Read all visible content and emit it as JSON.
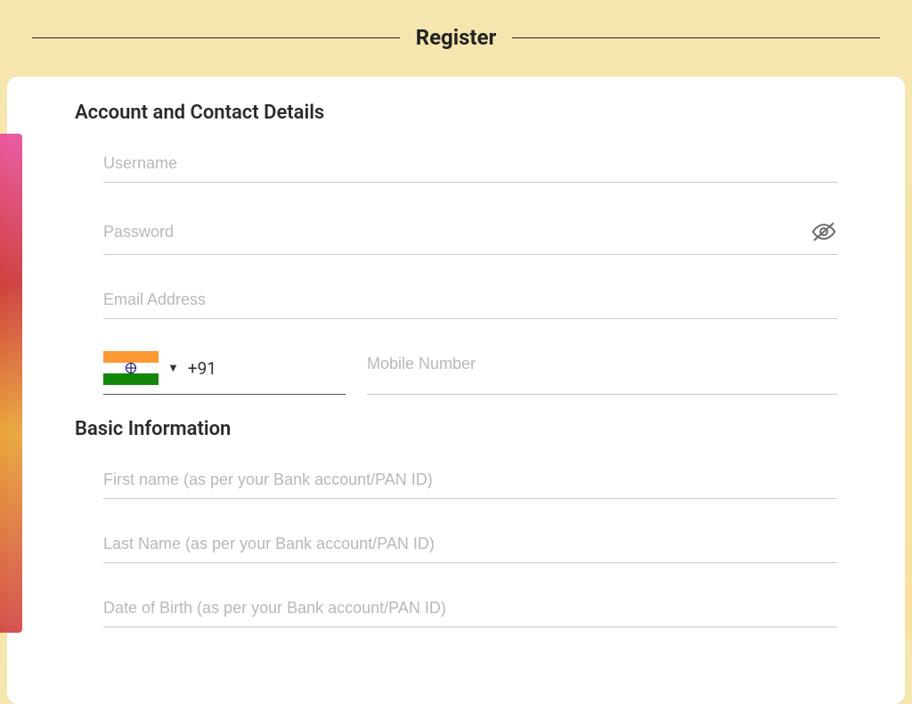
{
  "header": {
    "title": "Register"
  },
  "sections": {
    "account": {
      "title": "Account and Contact Details",
      "username": {
        "placeholder": "Username",
        "value": ""
      },
      "password": {
        "placeholder": "Password",
        "value": ""
      },
      "email": {
        "placeholder": "Email Address",
        "value": ""
      },
      "country_code": "+91",
      "mobile": {
        "placeholder": "Mobile Number",
        "value": ""
      }
    },
    "basic": {
      "title": "Basic Information",
      "first_name": {
        "placeholder": "First name (as per your Bank account/PAN ID)",
        "value": ""
      },
      "last_name": {
        "placeholder": "Last Name (as per your Bank account/PAN ID)",
        "value": ""
      },
      "dob": {
        "placeholder": "Date of Birth (as per your Bank account/PAN ID)",
        "value": ""
      }
    }
  }
}
